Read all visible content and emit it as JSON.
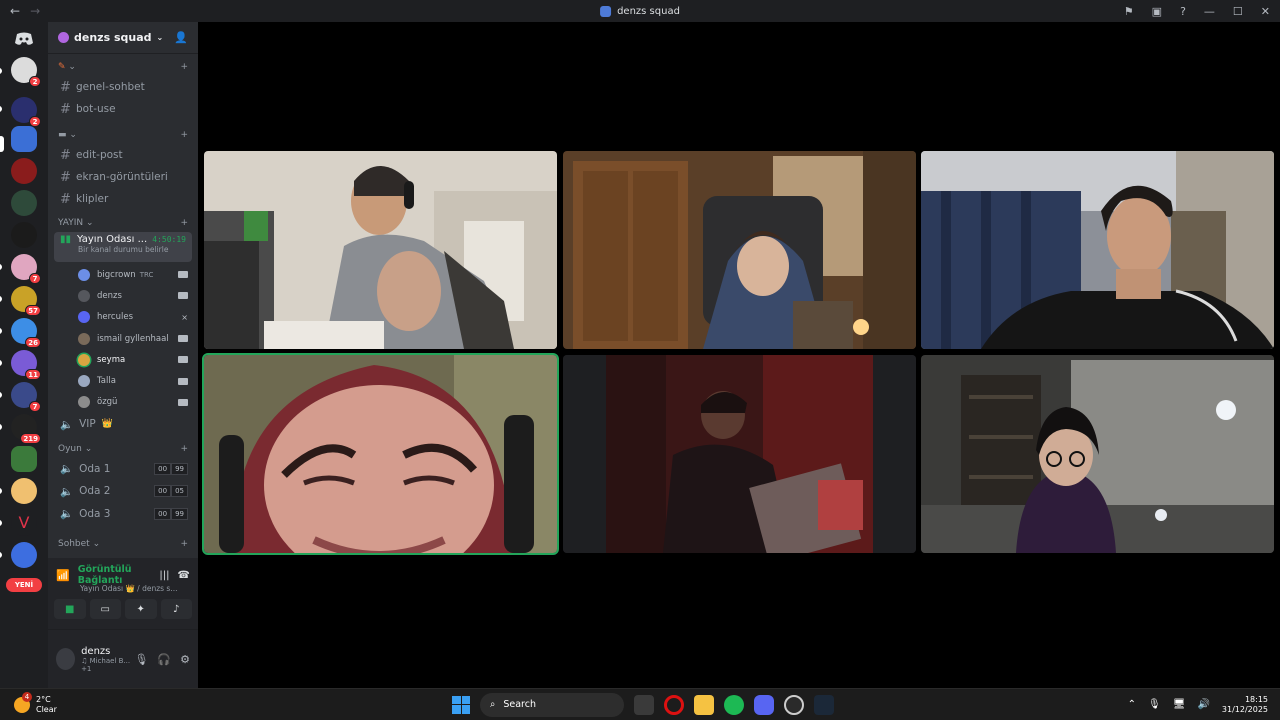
{
  "window": {
    "title": "denzs squad"
  },
  "server": {
    "name": "denzs squad"
  },
  "categories": {
    "yayin": "YAYIN",
    "oyun": "Oyun",
    "sohbet": "Sohbet"
  },
  "text_channels": [
    "genel-sohbet",
    "bot-use",
    "edit-post",
    "ekran-görüntüleri",
    "klipler"
  ],
  "active_voice": {
    "name": "Yayın Odası ...",
    "timer": "4:50:19",
    "status": "Bir kanal durumu belirle"
  },
  "members": [
    {
      "name": "bigcrown",
      "tag": "TRC",
      "color": "#6c8ee6"
    },
    {
      "name": "denzs",
      "tag": "",
      "color": "#55575d"
    },
    {
      "name": "hercules",
      "tag": "",
      "color": "#5865f2"
    },
    {
      "name": "ismail gyllenhaal",
      "tag": "",
      "color": "#7a6a5a"
    },
    {
      "name": "seyma",
      "tag": "",
      "color": "#d9a441"
    },
    {
      "name": "Talla",
      "tag": "",
      "color": "#9aa8c0"
    },
    {
      "name": "özgü",
      "tag": "",
      "color": "#8c8c8c"
    }
  ],
  "vip_channel": "VIP",
  "oyun_channels": [
    {
      "name": "Oda 1",
      "a": "00",
      "b": "99"
    },
    {
      "name": "Oda 2",
      "a": "00",
      "b": "05"
    },
    {
      "name": "Oda 3",
      "a": "00",
      "b": "99"
    }
  ],
  "rtc": {
    "status": "Görüntülü Bağlantı",
    "location": "Yayın Odası 👑 / denzs s..."
  },
  "user": {
    "name": "denzs",
    "status": "Michael B...",
    "extra": "+1"
  },
  "guild_badges": [
    "2",
    "2",
    "7",
    "57",
    "26",
    "11",
    "7",
    "219"
  ],
  "new_label": "YENİ",
  "taskbar": {
    "weather_temp": "2°C",
    "weather_desc": "Clear",
    "weather_badge": "4",
    "search": "Search",
    "time": "18:15",
    "date": "31/12/2025"
  },
  "colors": {
    "speaking": "#23a55a",
    "accent": "#5865f2",
    "bg": "#2b2d31"
  }
}
